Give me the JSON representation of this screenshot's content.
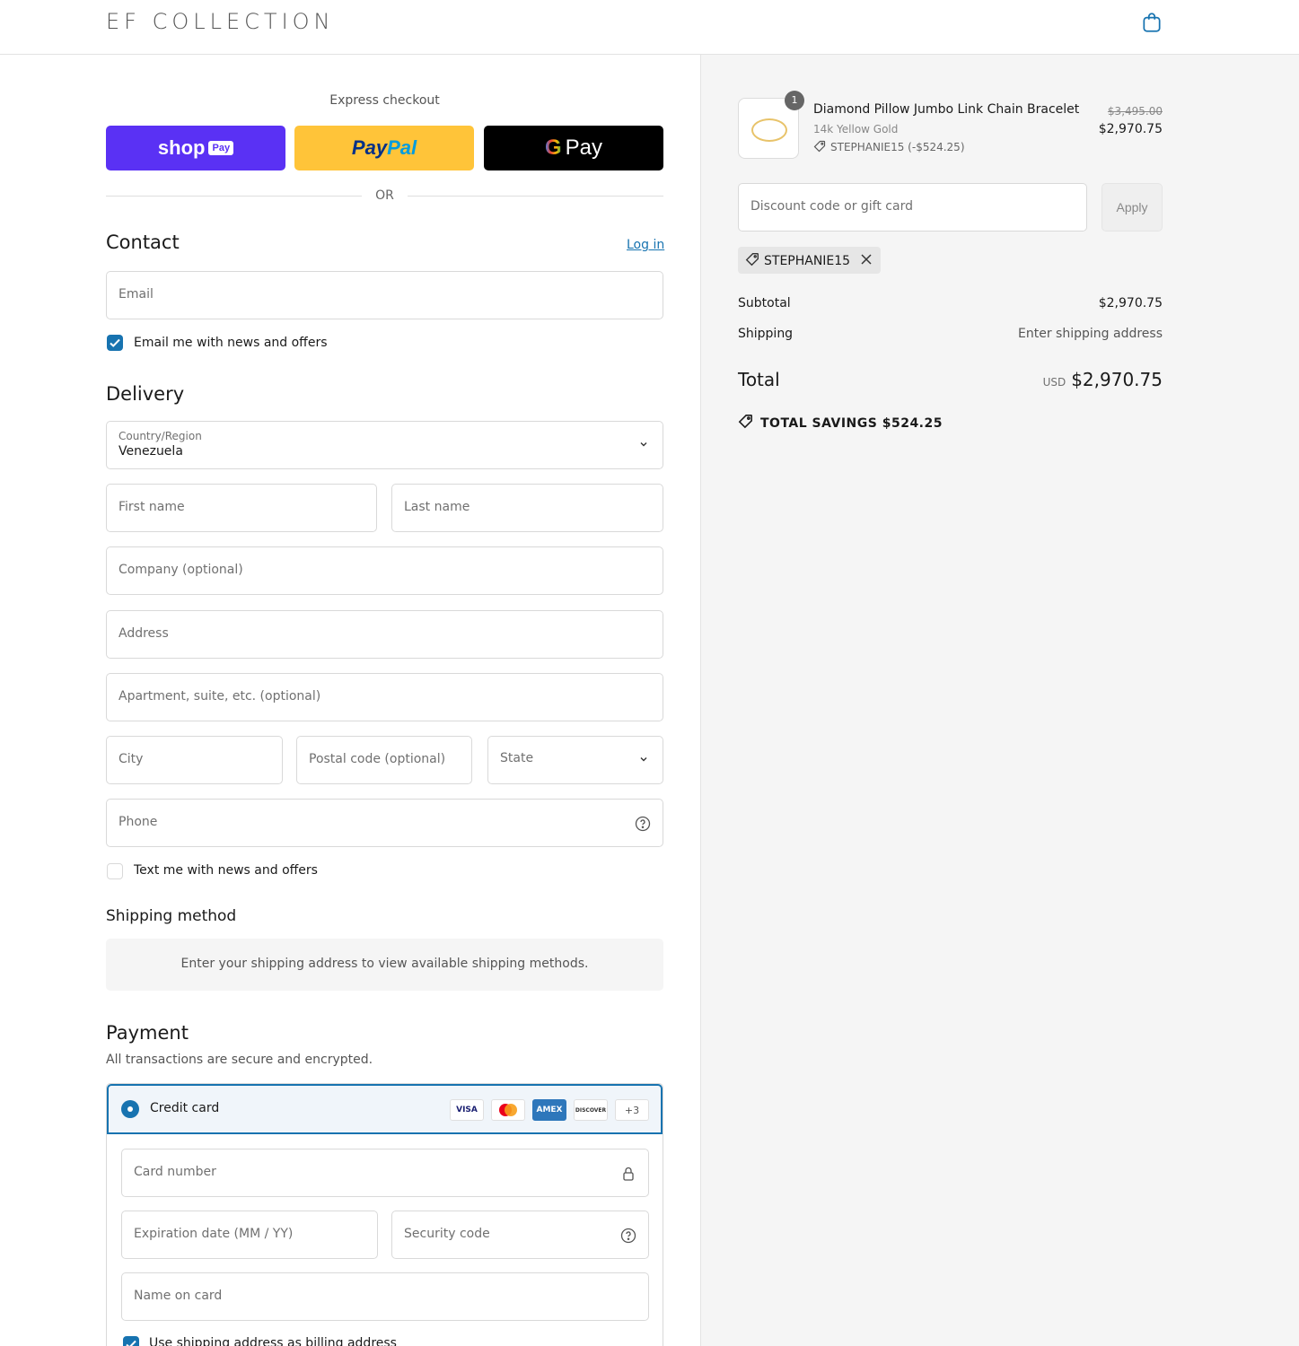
{
  "header": {
    "logo": "EF COLLECTION",
    "cart_icon": "shopping-bag-icon"
  },
  "express": {
    "title": "Express checkout",
    "shop_label": "shop",
    "shop_chip": "Pay",
    "paypal_a": "Pay",
    "paypal_b": "Pal",
    "gpay_g": "G",
    "gpay_label": "Pay",
    "or": "OR"
  },
  "contact": {
    "title": "Contact",
    "login": "Log in",
    "email_placeholder": "Email",
    "news_label": "Email me with news and offers",
    "news_checked": true
  },
  "delivery": {
    "title": "Delivery",
    "country_label": "Country/Region",
    "country_value": "Venezuela",
    "first_name": "First name",
    "last_name": "Last name",
    "company": "Company (optional)",
    "address": "Address",
    "apartment": "Apartment, suite, etc. (optional)",
    "city": "City",
    "postal": "Postal code (optional)",
    "state": "State",
    "phone": "Phone",
    "text_label": "Text me with news and offers",
    "text_checked": false
  },
  "shipping": {
    "title": "Shipping method",
    "message": "Enter your shipping address to view available shipping methods."
  },
  "payment": {
    "title": "Payment",
    "subtitle": "All transactions are secure and encrypted.",
    "method": "Credit card",
    "cards": [
      "VISA",
      "",
      "AMEX",
      "DISCOVER"
    ],
    "more": "+3",
    "card_number": "Card number",
    "expiry": "Expiration date (MM / YY)",
    "cvv": "Security code",
    "name": "Name on card",
    "billing_label": "Use shipping address as billing address",
    "accent": "#1773b0"
  },
  "summary": {
    "qty": "1",
    "product": "Diamond Pillow Jumbo Link Chain Bracelet",
    "variant": "14k Yellow Gold",
    "discount_line": "STEPHANIE15 (-$524.25)",
    "price_old": "$3,495.00",
    "price_new": "$2,970.75",
    "discount_placeholder": "Discount code or gift card",
    "apply": "Apply",
    "code": "STEPHANIE15",
    "subtotal_label": "Subtotal",
    "subtotal": "$2,970.75",
    "shipping_label": "Shipping",
    "shipping_value": "Enter shipping address",
    "total_label": "Total",
    "currency": "USD",
    "total": "$2,970.75",
    "savings": "TOTAL SAVINGS  $524.25"
  }
}
